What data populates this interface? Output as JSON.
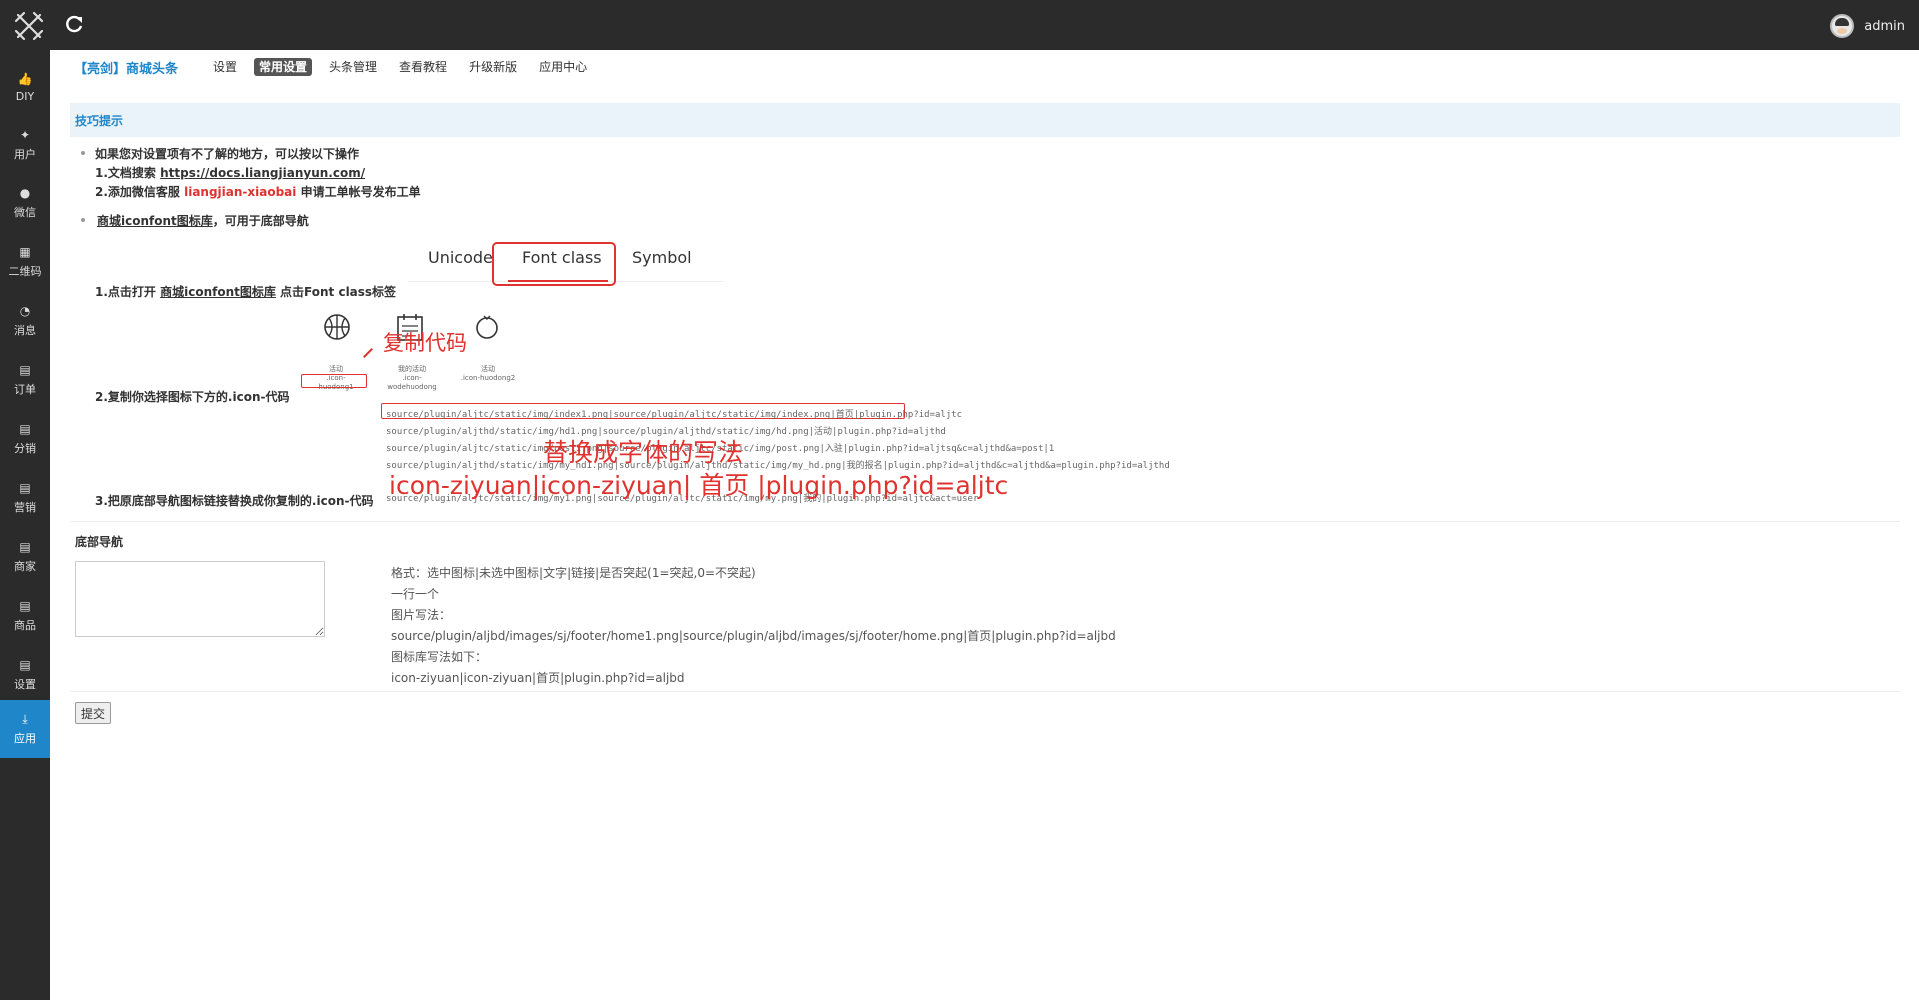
{
  "topbar": {
    "username": "admin"
  },
  "sidebar": {
    "items": [
      {
        "label": "DIY",
        "icon": "thumbs-up-icon"
      },
      {
        "label": "用户",
        "icon": "twitter-icon"
      },
      {
        "label": "微信",
        "icon": "wechat-icon"
      },
      {
        "label": "二维码",
        "icon": "qrcode-icon"
      },
      {
        "label": "消息",
        "icon": "message-icon"
      },
      {
        "label": "订单",
        "icon": "document-icon"
      },
      {
        "label": "分销",
        "icon": "document-icon"
      },
      {
        "label": "营销",
        "icon": "document-icon"
      },
      {
        "label": "商家",
        "icon": "document-icon"
      },
      {
        "label": "商品",
        "icon": "document-icon"
      },
      {
        "label": "设置",
        "icon": "document-icon"
      },
      {
        "label": "应用",
        "icon": "download-icon"
      }
    ]
  },
  "header": {
    "title": "【亮剑】商城头条",
    "nav": [
      "设置",
      "常用设置",
      "头条管理",
      "查看教程",
      "升级新版",
      "应用中心"
    ],
    "active_nav": "常用设置"
  },
  "tips": {
    "title": "技巧提示",
    "line1": "如果您对设置项有不了解的地方，可以按以下操作",
    "line2_prefix": "1.文档搜索 ",
    "line2_link": "https://docs.liangjianyun.com/",
    "line3_prefix": "2.添加微信客服 ",
    "line3_highlight": "liangjian-xiaobai",
    "line3_suffix": " 申请工单帐号发布工单",
    "line4_link": "商城iconfont图标库",
    "line4_suffix": "，可用于底部导航"
  },
  "steps": {
    "step1_prefix": "1.点击打开 ",
    "step1_link": "商城iconfont图标库",
    "step1_suffix": " 点击Font class标签",
    "step2": "2.复制你选择图标下方的.icon-代码",
    "step3": "3.把原底部导航图标链接替换成你复制的.icon-代码"
  },
  "illustration": {
    "tabs": [
      "Unicode",
      "Font class",
      "Symbol"
    ],
    "icons": [
      {
        "name": "活动",
        "code": ".icon-huodong1"
      },
      {
        "name": "我的活动",
        "code": ".icon-wodehuodong"
      },
      {
        "name": "活动",
        "code": ".icon-huodong2"
      }
    ],
    "copy_annotation": "复制代码",
    "replace_annotation": "替换成字体的写法",
    "replace_example": "icon-ziyuan|icon-ziyuan| 首页 |plugin.php?id=aljtc",
    "code_lines": [
      "source/plugin/aljtc/static/img/index1.png|source/plugin/aljtc/static/img/index.png|首页|plugin.php?id=aljtc",
      "source/plugin/aljthd/static/img/hd1.png|source/plugin/aljthd/static/img/hd.png|活动|plugin.php?id=aljthd",
      "source/plugin/aljtc/static/img/post1.png|source/plugin/aljtc/static/img/post.png|入驻|plugin.php?id=aljtsq&c=aljthd&a=post|1",
      "source/plugin/aljthd/static/img/my_hd1.png|source/plugin/aljthd/static/img/my_hd.png|我的报名|plugin.php?id=aljthd&c=aljthd&a=plugin.php?id=aljthd",
      "source/plugin/aljtc/static/img/my1.png|source/plugin/aljtc/static/img/my.png|我的|plugin.php?id=aljtc&act=user"
    ]
  },
  "footer_nav": {
    "label": "底部导航",
    "textarea_value": "",
    "format_lines": [
      "格式：选中图标|未选中图标|文字|链接|是否突起(1=突起,0=不突起)",
      "一行一个",
      "图片写法：",
      "source/plugin/aljbd/images/sj/footer/home1.png|source/plugin/aljbd/images/sj/footer/home.png|首页|plugin.php?id=aljbd",
      "图标库写法如下：",
      "icon-ziyuan|icon-ziyuan|首页|plugin.php?id=aljbd"
    ]
  },
  "submit_label": "提交",
  "colors": {
    "accent": "#1f87c9",
    "highlight_red": "#e0322f",
    "topbar": "#2b2b2b"
  }
}
